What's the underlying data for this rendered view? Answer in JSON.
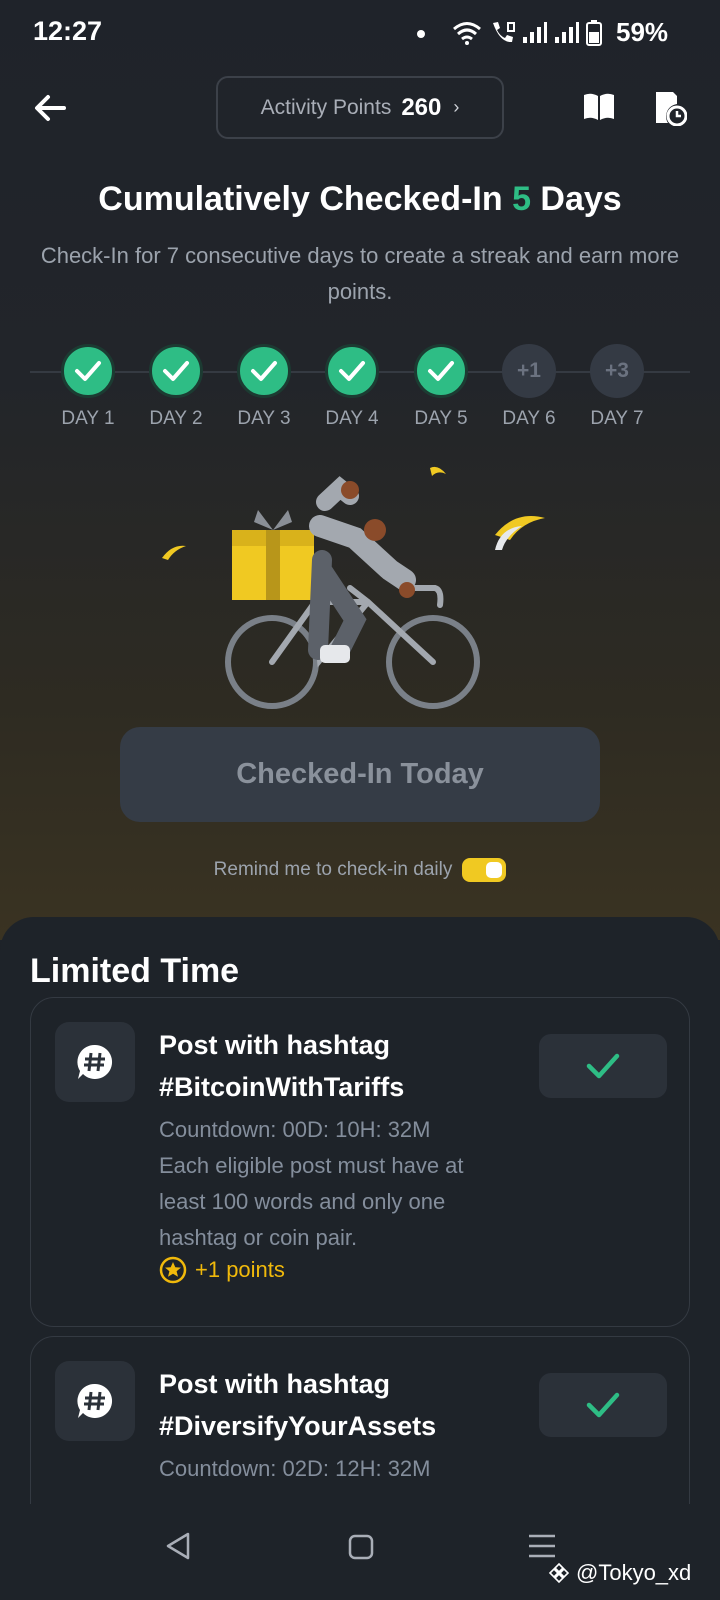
{
  "status_bar": {
    "time": "12:27",
    "battery": "59%"
  },
  "header": {
    "points_label": "Activity Points",
    "points_value": "260",
    "chevron": "›"
  },
  "title": {
    "prefix": "Cumulatively Checked-In ",
    "count": "5",
    "suffix": " Days"
  },
  "subtitle": "Check-In for 7 consecutive days to create a streak and earn more points.",
  "streak": {
    "days": [
      {
        "label": "DAY 1",
        "done": true,
        "bonus": ""
      },
      {
        "label": "DAY 2",
        "done": true,
        "bonus": ""
      },
      {
        "label": "DAY 3",
        "done": true,
        "bonus": ""
      },
      {
        "label": "DAY 4",
        "done": true,
        "bonus": ""
      },
      {
        "label": "DAY 5",
        "done": true,
        "bonus": ""
      },
      {
        "label": "DAY 6",
        "done": false,
        "bonus": "+1"
      },
      {
        "label": "DAY 7",
        "done": false,
        "bonus": "+3"
      }
    ],
    "accent": "#2ebd85"
  },
  "checkin_button": "Checked-In Today",
  "reminder": {
    "text": "Remind me to check-in daily",
    "enabled": true
  },
  "limited": {
    "title": "Limited Time",
    "tasks": [
      {
        "title": "Post with hashtag #BitcoinWithTariffs",
        "countdown": "Countdown: 00D: 10H: 32M",
        "description": "Each eligible post must have at least 100 words and only one hashtag or coin pair.",
        "reward": "+1 points"
      },
      {
        "title": "Post with hashtag #DiversifyYourAssets",
        "countdown": "Countdown: 02D: 12H: 32M",
        "description": "",
        "reward": ""
      }
    ]
  },
  "watermark": "@Tokyo_xd",
  "icons": [
    "back-arrow-icon",
    "book-icon",
    "history-clock-icon",
    "check-icon",
    "hashtag-chat-icon",
    "star-coin-icon"
  ]
}
